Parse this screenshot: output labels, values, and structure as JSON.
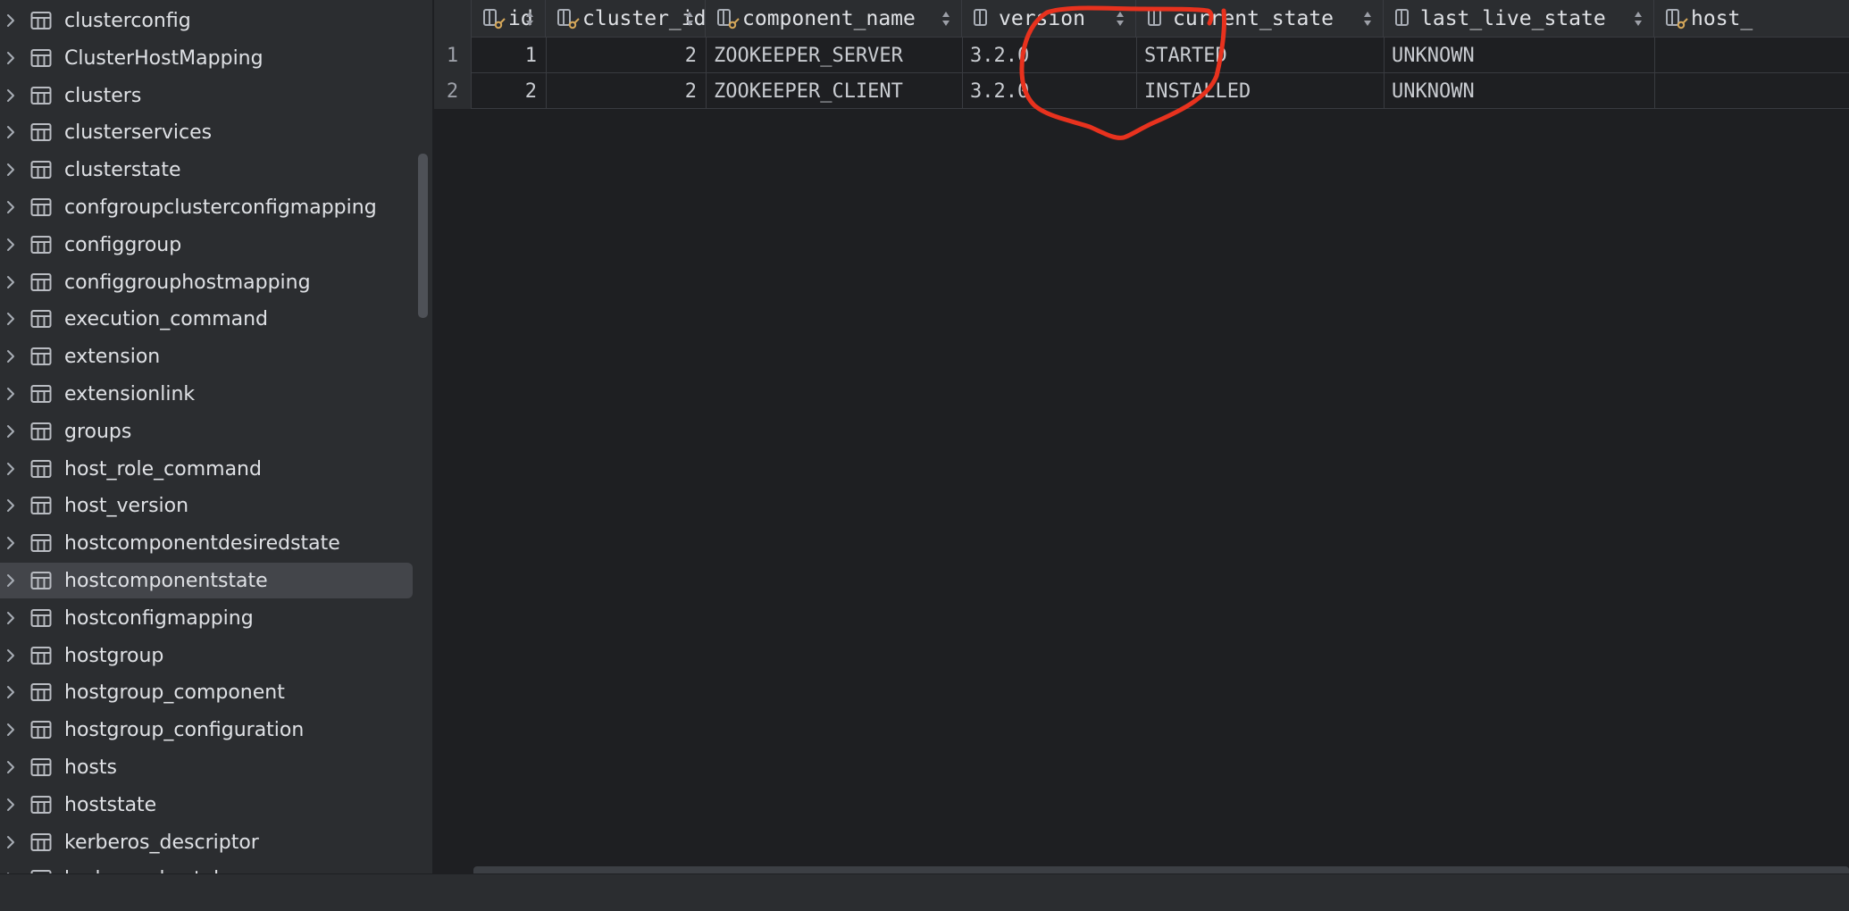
{
  "sidebar": {
    "items": [
      {
        "label": "clusterconfig"
      },
      {
        "label": "ClusterHostMapping"
      },
      {
        "label": "clusters"
      },
      {
        "label": "clusterservices"
      },
      {
        "label": "clusterstate"
      },
      {
        "label": "confgroupclusterconfigmapping"
      },
      {
        "label": "configgroup"
      },
      {
        "label": "configgrouphostmapping"
      },
      {
        "label": "execution_command"
      },
      {
        "label": "extension"
      },
      {
        "label": "extensionlink"
      },
      {
        "label": "groups"
      },
      {
        "label": "host_role_command"
      },
      {
        "label": "host_version"
      },
      {
        "label": "hostcomponentdesiredstate"
      },
      {
        "label": "hostcomponentstate",
        "selected": true
      },
      {
        "label": "hostconfigmapping"
      },
      {
        "label": "hostgroup"
      },
      {
        "label": "hostgroup_component"
      },
      {
        "label": "hostgroup_configuration"
      },
      {
        "label": "hosts"
      },
      {
        "label": "hoststate"
      },
      {
        "label": "kerberos_descriptor"
      },
      {
        "label": "kerberos_keytab"
      }
    ],
    "item_icon": "table-icon",
    "expand_icon": "chevron-right-icon"
  },
  "grid": {
    "columns": [
      {
        "label": "id",
        "icon": "key-column-icon"
      },
      {
        "label": "cluster_id",
        "icon": "key-column-icon"
      },
      {
        "label": "component_name",
        "icon": "key-column-icon"
      },
      {
        "label": "version",
        "icon": "column-icon"
      },
      {
        "label": "current_state",
        "icon": "column-icon"
      },
      {
        "label": "last_live_state",
        "icon": "column-icon"
      },
      {
        "label": "host_",
        "icon": "key-column-icon"
      }
    ],
    "rows": [
      {
        "num": "1",
        "id": "1",
        "cluster_id": "2",
        "component_name": "ZOOKEEPER_SERVER",
        "version": "3.2.0",
        "current_state": "STARTED",
        "last_live_state": "UNKNOWN",
        "host": ""
      },
      {
        "num": "2",
        "id": "2",
        "cluster_id": "2",
        "component_name": "ZOOKEEPER_CLIENT",
        "version": "3.2.0",
        "current_state": "INSTALLED",
        "last_live_state": "UNKNOWN",
        "host": ""
      }
    ],
    "sort_icon": "sort-icon"
  },
  "annotation": {
    "color": "#e8321e",
    "shape": "hand-drawn circle around version column"
  },
  "colors": {
    "background": "#1e1f22",
    "panel": "#2b2d30",
    "selection": "#43454a",
    "text": "#dfe1e5"
  }
}
